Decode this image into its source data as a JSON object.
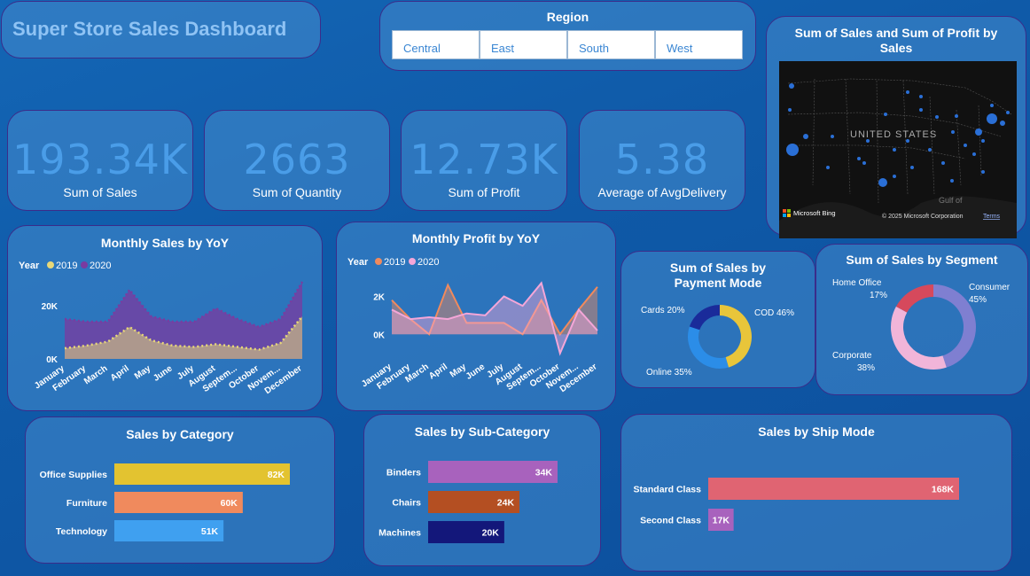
{
  "title": "Super Store Sales Dashboard",
  "region": {
    "title": "Region",
    "options": [
      "Central",
      "East",
      "South",
      "West"
    ]
  },
  "kpis": [
    {
      "value": "193.34K",
      "label": "Sum of Sales"
    },
    {
      "value": "2663",
      "label": "Sum of Quantity"
    },
    {
      "value": "12.73K",
      "label": "Sum of Profit"
    },
    {
      "value": "5.38",
      "label": "Average of AvgDelivery"
    }
  ],
  "map": {
    "title": "Sum of Sales and Sum of Profit by Sales",
    "country_label": "UNITED STATES",
    "gulf_label": "Gulf of",
    "bing": "Microsoft Bing",
    "copyright": "© 2025 Microsoft Corporation",
    "terms": "Terms"
  },
  "monthly_sales": {
    "title": "Monthly Sales by YoY",
    "legend_title": "Year"
  },
  "monthly_profit": {
    "title": "Monthly Profit by YoY",
    "legend_title": "Year"
  },
  "payment": {
    "title": "Sum of Sales by Payment Mode"
  },
  "segment": {
    "title": "Sum of Sales by Segment"
  },
  "category": {
    "title": "Sales by Category"
  },
  "subcategory": {
    "title": "Sales by Sub-Category"
  },
  "shipmode": {
    "title": "Sales by Ship Mode"
  },
  "months_display": [
    "January",
    "February",
    "March",
    "April",
    "May",
    "June",
    "July",
    "August",
    "Septem...",
    "October",
    "Novem...",
    "December"
  ],
  "chart_data": [
    {
      "id": "monthly_sales",
      "type": "area",
      "title": "Monthly Sales by YoY",
      "categories": [
        "January",
        "February",
        "March",
        "April",
        "May",
        "June",
        "July",
        "August",
        "September",
        "October",
        "November",
        "December"
      ],
      "ticks": [
        "0K",
        "20K"
      ],
      "ylim": [
        0,
        30000
      ],
      "legend": "top-left",
      "series": [
        {
          "name": "2019",
          "color": "#e8d878",
          "values": [
            4000,
            5000,
            6500,
            12000,
            7000,
            5000,
            4500,
            5500,
            4500,
            3500,
            6000,
            16000
          ]
        },
        {
          "name": "2020",
          "color": "#7b3ba0",
          "values": [
            15000,
            14000,
            14000,
            26000,
            16000,
            14000,
            14000,
            19000,
            15000,
            12000,
            15000,
            29000
          ]
        }
      ]
    },
    {
      "id": "monthly_profit",
      "type": "area",
      "title": "Monthly Profit by YoY",
      "categories": [
        "January",
        "February",
        "March",
        "April",
        "May",
        "June",
        "July",
        "August",
        "September",
        "October",
        "November",
        "December"
      ],
      "ticks": [
        "0K",
        "2K"
      ],
      "ylim": [
        -1200,
        3000
      ],
      "legend": "top-left",
      "series": [
        {
          "name": "2019",
          "color": "#f08a5d",
          "values": [
            1800,
            800,
            0,
            2600,
            600,
            600,
            600,
            0,
            1800,
            0,
            1300,
            2500
          ]
        },
        {
          "name": "2020",
          "color": "#f4a6d8",
          "values": [
            1300,
            800,
            900,
            800,
            1100,
            1000,
            2000,
            1500,
            2700,
            -1000,
            1300,
            200
          ]
        }
      ]
    },
    {
      "id": "payment",
      "type": "pie",
      "title": "Sum of Sales by Payment Mode",
      "slices": [
        {
          "label": "COD",
          "pct": 46,
          "display": "COD 46%",
          "color": "#e8c53a"
        },
        {
          "label": "Online",
          "pct": 35,
          "display": "Online 35%",
          "color": "#2b8de8"
        },
        {
          "label": "Cards",
          "pct": 20,
          "display": "Cards 20%",
          "color": "#1a2b9a"
        }
      ]
    },
    {
      "id": "segment",
      "type": "pie",
      "title": "Sum of Sales by Segment",
      "slices": [
        {
          "label": "Consumer",
          "pct": 45,
          "display": "45%",
          "color": "#7f7fd1"
        },
        {
          "label": "Corporate",
          "pct": 38,
          "display": "38%",
          "color": "#f1b5d9"
        },
        {
          "label": "Home Office",
          "pct": 17,
          "display": "17%",
          "color": "#d6495c"
        }
      ]
    },
    {
      "id": "category",
      "type": "bar",
      "title": "Sales by Category",
      "categories": [
        "Office Supplies",
        "Furniture",
        "Technology"
      ],
      "values": [
        82000,
        60000,
        51000
      ],
      "labels": [
        "82K",
        "60K",
        "51K"
      ],
      "colors": [
        "#e3c330",
        "#f08a5d",
        "#3fa0f0"
      ],
      "xlim": [
        0,
        82000
      ]
    },
    {
      "id": "subcategory",
      "type": "bar",
      "title": "Sales by Sub-Category",
      "categories": [
        "Binders",
        "Chairs",
        "Machines"
      ],
      "values": [
        34000,
        24000,
        20000
      ],
      "labels": [
        "34K",
        "24K",
        "20K"
      ],
      "colors": [
        "#a862bd",
        "#b44f22",
        "#13177a"
      ],
      "xlim": [
        0,
        34000
      ]
    },
    {
      "id": "shipmode",
      "type": "bar",
      "title": "Sales by Ship Mode",
      "categories": [
        "Standard Class",
        "Second Class"
      ],
      "values": [
        168000,
        17000
      ],
      "labels": [
        "168K",
        "17K"
      ],
      "colors": [
        "#e06472",
        "#a862bd"
      ],
      "xlim": [
        0,
        168000
      ]
    }
  ]
}
